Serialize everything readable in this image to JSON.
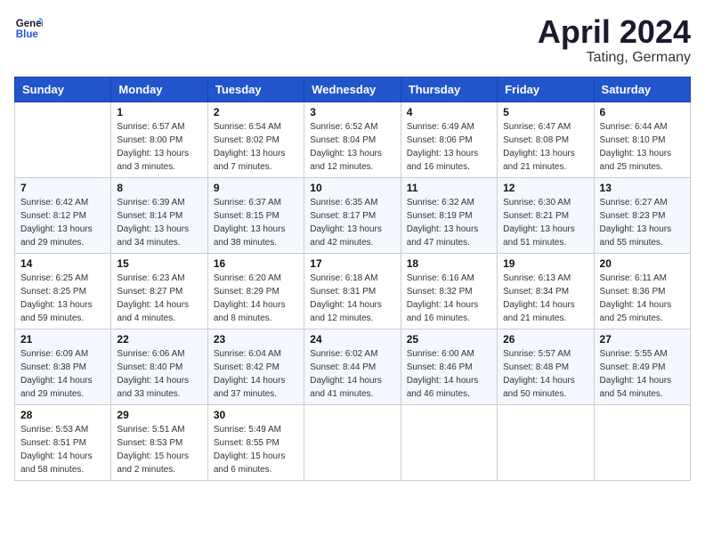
{
  "header": {
    "logo_line1": "General",
    "logo_line2": "Blue",
    "title": "April 2024",
    "subtitle": "Tating, Germany"
  },
  "columns": [
    "Sunday",
    "Monday",
    "Tuesday",
    "Wednesday",
    "Thursday",
    "Friday",
    "Saturday"
  ],
  "weeks": [
    [
      {
        "day": "",
        "info": ""
      },
      {
        "day": "1",
        "info": "Sunrise: 6:57 AM\nSunset: 8:00 PM\nDaylight: 13 hours\nand 3 minutes."
      },
      {
        "day": "2",
        "info": "Sunrise: 6:54 AM\nSunset: 8:02 PM\nDaylight: 13 hours\nand 7 minutes."
      },
      {
        "day": "3",
        "info": "Sunrise: 6:52 AM\nSunset: 8:04 PM\nDaylight: 13 hours\nand 12 minutes."
      },
      {
        "day": "4",
        "info": "Sunrise: 6:49 AM\nSunset: 8:06 PM\nDaylight: 13 hours\nand 16 minutes."
      },
      {
        "day": "5",
        "info": "Sunrise: 6:47 AM\nSunset: 8:08 PM\nDaylight: 13 hours\nand 21 minutes."
      },
      {
        "day": "6",
        "info": "Sunrise: 6:44 AM\nSunset: 8:10 PM\nDaylight: 13 hours\nand 25 minutes."
      }
    ],
    [
      {
        "day": "7",
        "info": "Sunrise: 6:42 AM\nSunset: 8:12 PM\nDaylight: 13 hours\nand 29 minutes."
      },
      {
        "day": "8",
        "info": "Sunrise: 6:39 AM\nSunset: 8:14 PM\nDaylight: 13 hours\nand 34 minutes."
      },
      {
        "day": "9",
        "info": "Sunrise: 6:37 AM\nSunset: 8:15 PM\nDaylight: 13 hours\nand 38 minutes."
      },
      {
        "day": "10",
        "info": "Sunrise: 6:35 AM\nSunset: 8:17 PM\nDaylight: 13 hours\nand 42 minutes."
      },
      {
        "day": "11",
        "info": "Sunrise: 6:32 AM\nSunset: 8:19 PM\nDaylight: 13 hours\nand 47 minutes."
      },
      {
        "day": "12",
        "info": "Sunrise: 6:30 AM\nSunset: 8:21 PM\nDaylight: 13 hours\nand 51 minutes."
      },
      {
        "day": "13",
        "info": "Sunrise: 6:27 AM\nSunset: 8:23 PM\nDaylight: 13 hours\nand 55 minutes."
      }
    ],
    [
      {
        "day": "14",
        "info": "Sunrise: 6:25 AM\nSunset: 8:25 PM\nDaylight: 13 hours\nand 59 minutes."
      },
      {
        "day": "15",
        "info": "Sunrise: 6:23 AM\nSunset: 8:27 PM\nDaylight: 14 hours\nand 4 minutes."
      },
      {
        "day": "16",
        "info": "Sunrise: 6:20 AM\nSunset: 8:29 PM\nDaylight: 14 hours\nand 8 minutes."
      },
      {
        "day": "17",
        "info": "Sunrise: 6:18 AM\nSunset: 8:31 PM\nDaylight: 14 hours\nand 12 minutes."
      },
      {
        "day": "18",
        "info": "Sunrise: 6:16 AM\nSunset: 8:32 PM\nDaylight: 14 hours\nand 16 minutes."
      },
      {
        "day": "19",
        "info": "Sunrise: 6:13 AM\nSunset: 8:34 PM\nDaylight: 14 hours\nand 21 minutes."
      },
      {
        "day": "20",
        "info": "Sunrise: 6:11 AM\nSunset: 8:36 PM\nDaylight: 14 hours\nand 25 minutes."
      }
    ],
    [
      {
        "day": "21",
        "info": "Sunrise: 6:09 AM\nSunset: 8:38 PM\nDaylight: 14 hours\nand 29 minutes."
      },
      {
        "day": "22",
        "info": "Sunrise: 6:06 AM\nSunset: 8:40 PM\nDaylight: 14 hours\nand 33 minutes."
      },
      {
        "day": "23",
        "info": "Sunrise: 6:04 AM\nSunset: 8:42 PM\nDaylight: 14 hours\nand 37 minutes."
      },
      {
        "day": "24",
        "info": "Sunrise: 6:02 AM\nSunset: 8:44 PM\nDaylight: 14 hours\nand 41 minutes."
      },
      {
        "day": "25",
        "info": "Sunrise: 6:00 AM\nSunset: 8:46 PM\nDaylight: 14 hours\nand 46 minutes."
      },
      {
        "day": "26",
        "info": "Sunrise: 5:57 AM\nSunset: 8:48 PM\nDaylight: 14 hours\nand 50 minutes."
      },
      {
        "day": "27",
        "info": "Sunrise: 5:55 AM\nSunset: 8:49 PM\nDaylight: 14 hours\nand 54 minutes."
      }
    ],
    [
      {
        "day": "28",
        "info": "Sunrise: 5:53 AM\nSunset: 8:51 PM\nDaylight: 14 hours\nand 58 minutes."
      },
      {
        "day": "29",
        "info": "Sunrise: 5:51 AM\nSunset: 8:53 PM\nDaylight: 15 hours\nand 2 minutes."
      },
      {
        "day": "30",
        "info": "Sunrise: 5:49 AM\nSunset: 8:55 PM\nDaylight: 15 hours\nand 6 minutes."
      },
      {
        "day": "",
        "info": ""
      },
      {
        "day": "",
        "info": ""
      },
      {
        "day": "",
        "info": ""
      },
      {
        "day": "",
        "info": ""
      }
    ]
  ]
}
